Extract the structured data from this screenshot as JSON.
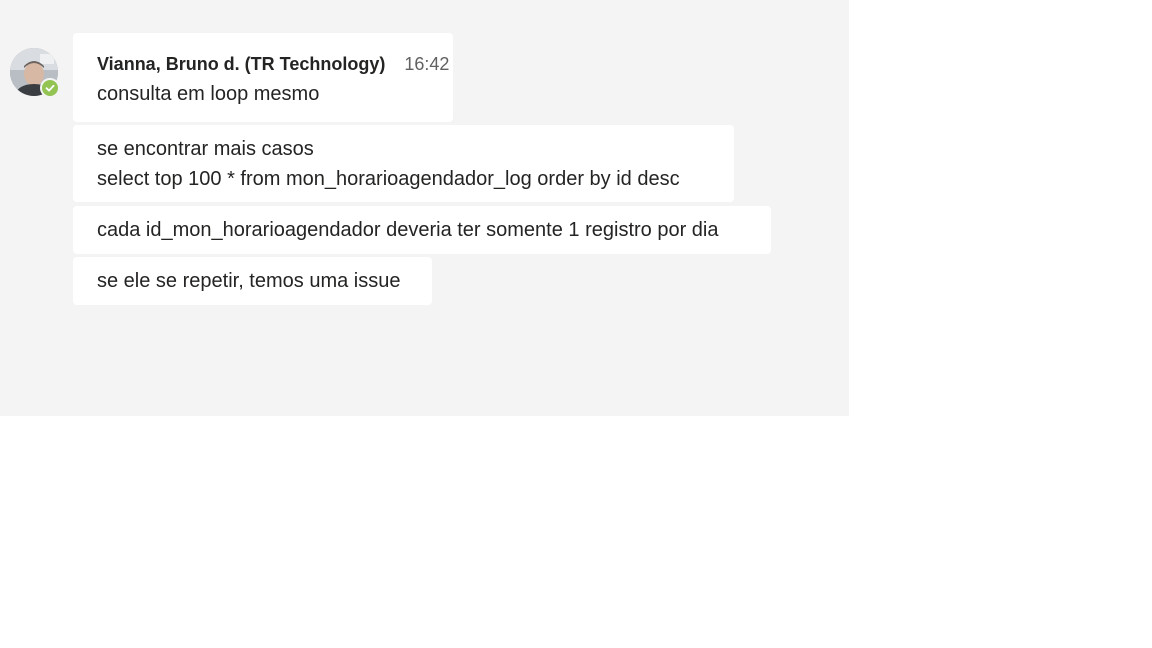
{
  "message_group": {
    "sender": {
      "name": "Vianna, Bruno d. (TR Technology)",
      "avatar_icon": "user-avatar",
      "presence": "available",
      "presence_color": "#92c353"
    },
    "timestamp": "16:42",
    "messages": [
      {
        "lines": [
          "consulta em loop mesmo"
        ]
      },
      {
        "lines": [
          "se encontrar mais casos",
          "select top 100 * from mon_horarioagendador_log order by id desc"
        ]
      },
      {
        "lines": [
          "cada id_mon_horarioagendador deveria ter somente 1 registro por dia"
        ]
      },
      {
        "lines": [
          "se ele se repetir, temos uma issue"
        ]
      }
    ]
  },
  "colors": {
    "panel_background": "#f4f4f4",
    "bubble_background": "#ffffff",
    "text": "#252423",
    "timestamp": "#616161"
  }
}
